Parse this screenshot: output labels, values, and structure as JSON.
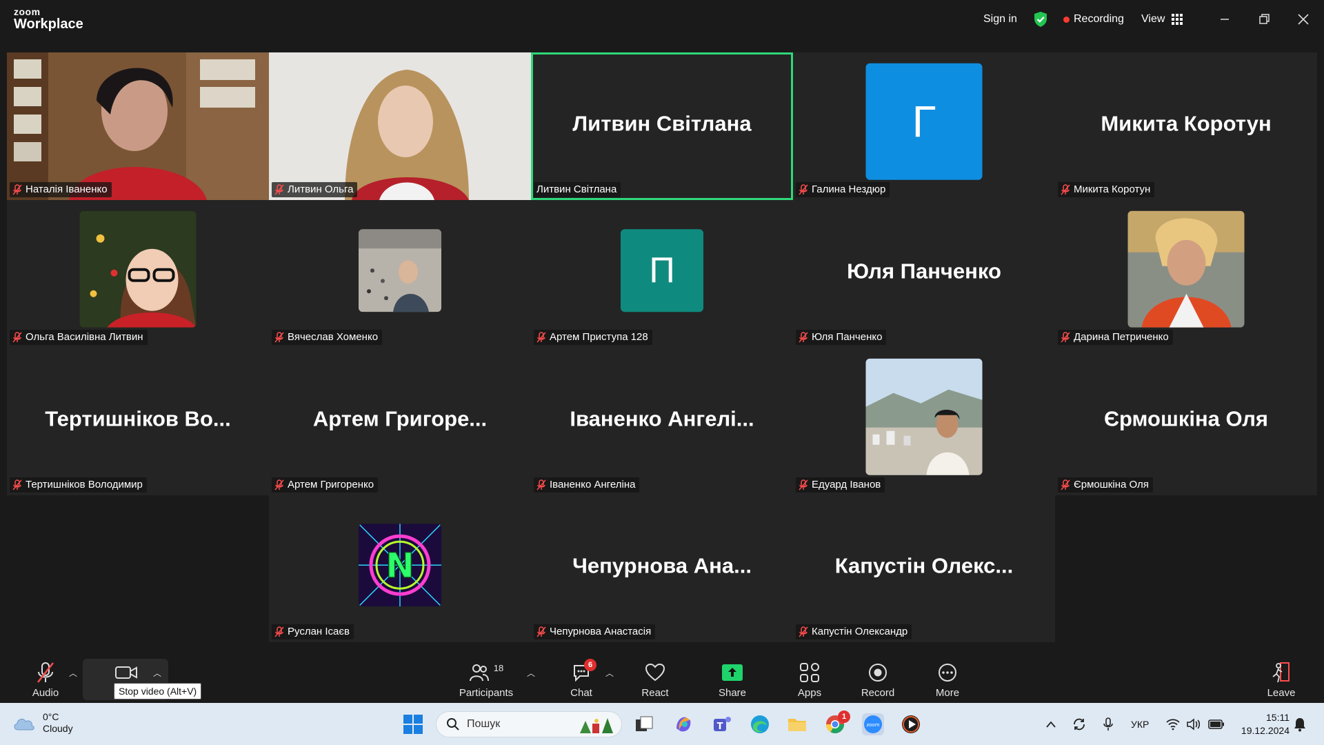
{
  "app": {
    "brand_top": "zoom",
    "brand_bottom": "Workplace"
  },
  "titlebar": {
    "sign_in": "Sign in",
    "recording": "Recording",
    "view": "View"
  },
  "colors": {
    "active_speaker": "#2ed87a",
    "recording_dot": "#ff3b30",
    "tile_bg": "#242424",
    "share_green": "#1fd36b"
  },
  "participants": [
    {
      "label": "Наталія Іваненко",
      "kind": "video",
      "muted": true
    },
    {
      "label": "Литвин Ольга",
      "kind": "video",
      "muted": false
    },
    {
      "label": "Литвин Світлана",
      "big": "Литвин Світлана",
      "kind": "name",
      "active": true,
      "muted": false
    },
    {
      "label": "Галина Нездюр",
      "kind": "letter",
      "letter": "Г",
      "color": "#0e8ee0",
      "muted": true
    },
    {
      "label": "Микита Коротун",
      "big": "Микита Коротун",
      "kind": "name",
      "muted": true
    },
    {
      "label": "Ольга Василівна Литвин",
      "kind": "photo",
      "muted": true
    },
    {
      "label": "Вячеслав Хоменко",
      "kind": "photo",
      "muted": true
    },
    {
      "label": "Артем Приступа 128",
      "kind": "letter",
      "letter": "П",
      "color": "#0f8a7e",
      "muted": true
    },
    {
      "label": "Юля Панченко",
      "big": "Юля Панченко",
      "kind": "name",
      "muted": true
    },
    {
      "label": "Дарина Петриченко",
      "kind": "photo",
      "muted": true
    },
    {
      "label": "Тертишніков Володимир",
      "big": "Тертишніков Во...",
      "kind": "name",
      "muted": true
    },
    {
      "label": "Артем Григоренко",
      "big": "Артем  Григоре...",
      "kind": "name",
      "muted": true
    },
    {
      "label": "Іваненко Ангеліна",
      "big": "Іваненко  Ангелі...",
      "kind": "name",
      "muted": true
    },
    {
      "label": "Едуард Іванов",
      "kind": "photo",
      "muted": true
    },
    {
      "label": "Єрмошкіна Оля",
      "big": "Єрмошкіна Оля",
      "kind": "name",
      "muted": true
    },
    {
      "label": "Руслан  Ісаєв",
      "kind": "logo",
      "muted": true
    },
    {
      "label": "Чепурнова Анастасія",
      "big": "Чепурнова  Ана...",
      "kind": "name",
      "muted": true
    },
    {
      "label": "Капустін Олександр",
      "big": "Капустін  Олекс...",
      "kind": "name",
      "muted": true
    }
  ],
  "toolbar": {
    "audio": "Audio",
    "video_tooltip": "Stop video (Alt+V)",
    "participants": "Participants",
    "participants_count": "18",
    "chat": "Chat",
    "chat_badge": "6",
    "react": "React",
    "share": "Share",
    "apps": "Apps",
    "record": "Record",
    "more": "More",
    "leave": "Leave"
  },
  "taskbar": {
    "temperature": "0°C",
    "weather": "Cloudy",
    "search_placeholder": "Пошук",
    "language": "УКР",
    "time": "15:11",
    "date": "19.12.2024",
    "chrome_badge": "1"
  }
}
